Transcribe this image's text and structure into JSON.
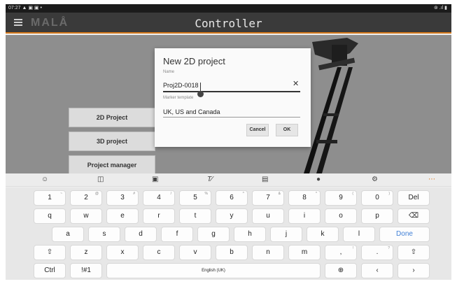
{
  "status_bar": {
    "time": "07:27",
    "left_icons": "▲ ▣ ▣ •",
    "right_icons": "⊚ .ıl ▮"
  },
  "app_bar": {
    "logo": "MALÅ",
    "title": "Controller"
  },
  "menu": {
    "items": [
      "2D Project",
      "3D project",
      "Project manager"
    ]
  },
  "dialog": {
    "title": "New 2D project",
    "name_label": "Name",
    "name_value": "Proj2D-0018",
    "marker_label": "Marker template",
    "marker_value": "UK, US and Canada",
    "cancel_label": "Cancel",
    "ok_label": "OK"
  },
  "keyboard_toolbar": {
    "icons": [
      "emoji-icon",
      "sticker-icon",
      "gif-icon",
      "handwriting-icon",
      "clipboard-icon",
      "microphone-icon",
      "settings-icon",
      "more-icon"
    ]
  },
  "keyboard": {
    "row_numbers": [
      {
        "key": "1",
        "hint": "~"
      },
      {
        "key": "2",
        "hint": "@"
      },
      {
        "key": "3",
        "hint": "#"
      },
      {
        "key": "4",
        "hint": "/"
      },
      {
        "key": "5",
        "hint": "%"
      },
      {
        "key": "6",
        "hint": "^"
      },
      {
        "key": "7",
        "hint": "&"
      },
      {
        "key": "8",
        "hint": "*"
      },
      {
        "key": "9",
        "hint": "("
      },
      {
        "key": "0",
        "hint": ")"
      },
      {
        "key": "Del",
        "hint": ""
      }
    ],
    "row_top": [
      "q",
      "w",
      "e",
      "r",
      "t",
      "y",
      "u",
      "i",
      "o",
      "p"
    ],
    "row_middle": [
      "a",
      "s",
      "d",
      "f",
      "g",
      "h",
      "j",
      "k",
      "l"
    ],
    "done_label": "Done",
    "row_bottom": [
      "z",
      "x",
      "c",
      "v",
      "b",
      "n",
      "m",
      ",",
      "."
    ],
    "row_bottom_hints": [
      "",
      "",
      "",
      "",
      "",
      "",
      "",
      "!",
      "?"
    ],
    "ctrl_label": "Ctrl",
    "symbols_label": "!#1",
    "space_label": "English (UK)"
  }
}
